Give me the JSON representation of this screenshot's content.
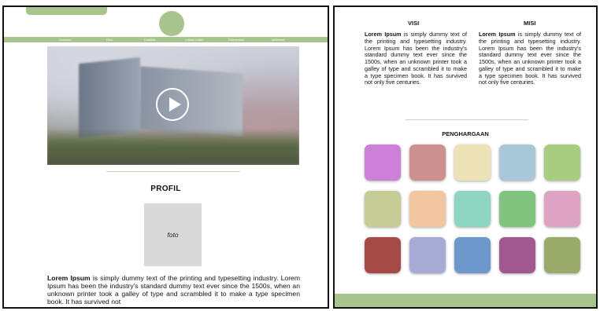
{
  "profile_page": {
    "nav_items": [
      "Services",
      "Fitur",
      "Fasilitas",
      "Lokasi Outlet",
      "Partnership",
      "Informasi"
    ],
    "section_title": "PROFIL",
    "photo_placeholder": "foto",
    "paragraph_lead": "Lorem Ipsum",
    "paragraph_rest": " is simply dummy text of the printing and typesetting industry. Lorem Ipsum has been the industry's standard dummy text ever since the 1500s, when an unknown printer took a galley of type and scrambled it to make a type specimen book. It has survived not"
  },
  "visi_misi_page": {
    "visi": {
      "title": "VISI",
      "lead": "Lorem Ipsum",
      "rest": " is simply dummy text of the printing and typesetting industry. Lorem Ipsum has been the industry's standard dummy text ever since the 1500s, when an unknown printer took a galley of type and scrambled it to make a type specimen book. It has survived not only five centuries."
    },
    "misi": {
      "title": "MISI",
      "lead": "Lorem Ipsum",
      "rest": " is simply dummy text of the printing and typesetting industry. Lorem Ipsum has been the industry's standard dummy text ever since the 1500s, when an unknown printer took a galley of type and scrambled it to make a type specimen book. It has survived not only five centuries."
    },
    "awards_title": "PENGHARGAAN",
    "award_colors": [
      "#cc80d8",
      "#cc9090",
      "#ede2b6",
      "#a8c8d8",
      "#a8cc80",
      "#c6cc96",
      "#f2c6a0",
      "#8ed6c2",
      "#80c480",
      "#dea2c2",
      "#a64a48",
      "#a8aad6",
      "#6e98cc",
      "#a0588e",
      "#9aaa6a"
    ]
  },
  "theme": {
    "accent": "#a6c48c"
  }
}
